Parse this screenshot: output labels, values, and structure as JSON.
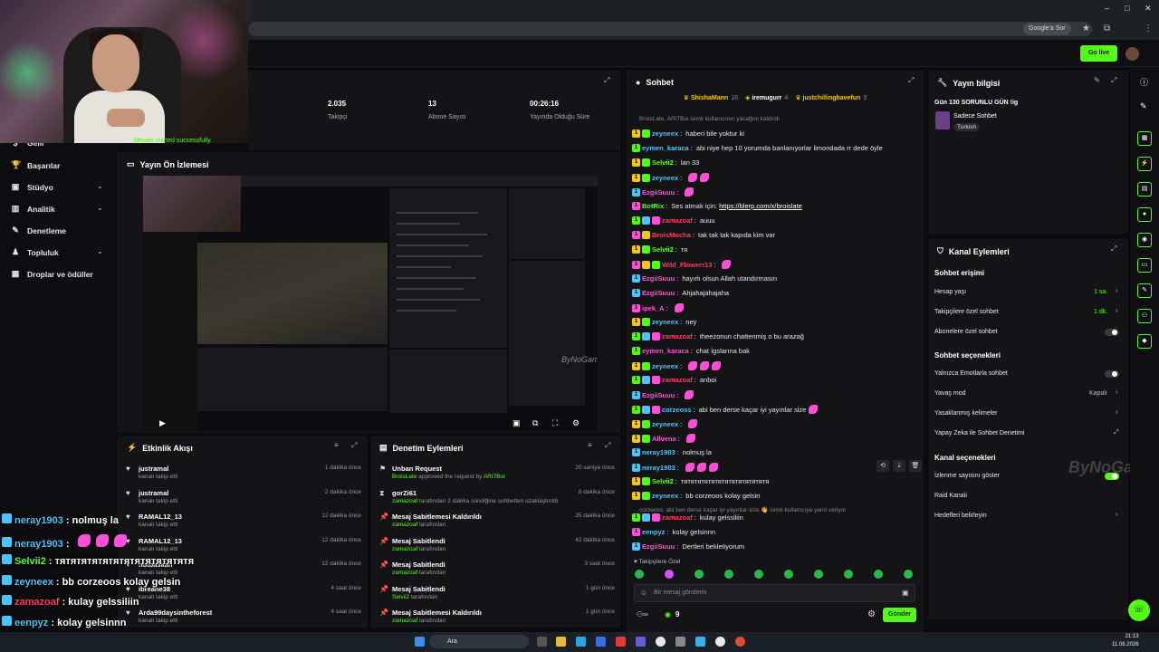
{
  "browser": {
    "google_ask": "Google'a Sor"
  },
  "app": {
    "go_live": "Go live"
  },
  "stream_note": "Stream started successfully.",
  "nav": {
    "items": [
      {
        "label": "Gelir",
        "icon": "dollar-icon"
      },
      {
        "label": "Başarılar",
        "icon": "trophy-icon"
      },
      {
        "label": "Stüdyo",
        "icon": "studio-icon",
        "chevron": true
      },
      {
        "label": "Analitik",
        "icon": "analytics-icon",
        "chevron": true
      },
      {
        "label": "Denetleme",
        "icon": "moderation-icon"
      },
      {
        "label": "Topluluk",
        "icon": "community-icon",
        "chevron": true
      },
      {
        "label": "Droplar ve ödüller",
        "icon": "drops-icon"
      }
    ]
  },
  "stats": [
    {
      "value": "2.035",
      "label": "Takipçi"
    },
    {
      "value": "13",
      "label": "Abone Sayısı"
    },
    {
      "value": "00:26:16",
      "label": "Yayında Olduğu Süre"
    }
  ],
  "preview": {
    "title": "Yayın Ön İzlemesi",
    "watermark": "ByNoGame"
  },
  "activity": {
    "title": "Etkinlik Akışı",
    "items": [
      {
        "user": "justramal",
        "sub": "kanalı takip etti",
        "time": "1 dakika önce"
      },
      {
        "user": "justramal",
        "sub": "kanalı takip etti",
        "time": "2 dakika önce"
      },
      {
        "user": "RAMAL12_13",
        "sub": "kanalı takip etti",
        "time": "12 dakika önce"
      },
      {
        "user": "RAMAL12_13",
        "sub": "kanalı takip etti",
        "time": "12 dakika önce"
      },
      {
        "user": "notbaskan",
        "sub": "kanalı takip etti",
        "time": "12 dakika önce"
      },
      {
        "user": "ibreane38",
        "sub": "kanalı takip etti",
        "time": "4 saat önce"
      },
      {
        "user": "Arda99daysintheforest",
        "sub": "kanalı takip etti",
        "time": "4 saat önce"
      }
    ]
  },
  "moderation": {
    "title": "Denetim Eylemleri",
    "items": [
      {
        "title": "Unban Request",
        "sub_user": "BroisLate",
        "sub_text": " approved the request by ",
        "sub_user2": "ARI7Boi",
        "time": "20 saniye önce"
      },
      {
        "title": "gorZi61",
        "sub_user": "zamazoaf",
        "sub_text": " tarafından 2 dakika süreliğine sohbetten uzaklaştırıldı",
        "sub_user2": "",
        "time": "6 dakika önce"
      },
      {
        "title": "Mesaj Sabitlemesi Kaldırıldı",
        "sub_user": "zamazoaf",
        "sub_text": " tarafından",
        "sub_user2": "",
        "time": "25 dakika önce"
      },
      {
        "title": "Mesaj Sabitlendi",
        "sub_user": "zamazoaf",
        "sub_text": " tarafından",
        "sub_user2": "",
        "time": "42 dakika önce"
      },
      {
        "title": "Mesaj Sabitlendi",
        "sub_user": "zamazoaf",
        "sub_text": " tarafından",
        "sub_user2": "",
        "time": "3 saat önce"
      },
      {
        "title": "Mesaj Sabitlendi",
        "sub_user": "Selvii2",
        "sub_text": " tarafından",
        "sub_user2": "",
        "time": "1 gün önce"
      },
      {
        "title": "Mesaj Sabitlemesi Kaldırıldı",
        "sub_user": "zamazoaf",
        "sub_text": " tarafından",
        "sub_user2": "",
        "time": "1 gün önce"
      }
    ]
  },
  "chat": {
    "title": "Sohbet",
    "top_gifters": [
      {
        "name": "ShishaMann",
        "count": "16"
      },
      {
        "name": "iremugurr",
        "count": "4"
      },
      {
        "name": "justchillinghavefun",
        "count": "3"
      }
    ],
    "system_top": "BroisLate, ARI7Boi isimli kullanıcının yasağını kaldırdı",
    "messages": [
      {
        "user": "zeyneex",
        "color": "#4fc3f7",
        "text": "haberi bile yoktur ki",
        "emotes": 0
      },
      {
        "user": "eymen_karaca",
        "color": "#4fc3f7",
        "text": "abi niye hep 10 yorumda banlanıyorlar limondada rr dede öyle",
        "emotes": 0
      },
      {
        "user": "Selvii2",
        "color": "#53fc18",
        "text": "lan 33",
        "emotes": 0
      },
      {
        "user": "zeyneex",
        "color": "#4fc3f7",
        "text": "",
        "emotes": 2
      },
      {
        "user": "EzgiiSuuu",
        "color": "#ff4fd8",
        "text": "",
        "emotes": 1
      },
      {
        "user": "BotRix",
        "color": "#53fc18",
        "text": "Ses atmak için: ",
        "link": "https://blerp.com/x/broislate",
        "emotes": 0
      },
      {
        "user": "zamazoaf",
        "color": "#ff3b5c",
        "text": "auuu",
        "emotes": 0
      },
      {
        "user": "BroisMocha",
        "color": "#ff3b5c",
        "text": "tak tak tak kapıda kim var",
        "emotes": 0
      },
      {
        "user": "Selvii2",
        "color": "#53fc18",
        "text": "тя",
        "emotes": 0
      },
      {
        "user": "Wild_Flowerr13",
        "color": "#ff3b5c",
        "text": "",
        "emotes": 1
      },
      {
        "user": "EzgiiSuuu",
        "color": "#ff4fd8",
        "text": "hayırlı olsun Allah utandırmasın",
        "emotes": 0
      },
      {
        "user": "EzgiiSuuu",
        "color": "#ff4fd8",
        "text": "Ahjahajahajaha",
        "emotes": 0
      },
      {
        "user": "ipek_A",
        "color": "#ff4fd8",
        "text": "",
        "emotes": 1
      },
      {
        "user": "zeyneex",
        "color": "#4fc3f7",
        "text": "ney",
        "emotes": 0
      },
      {
        "user": "zamazoaf",
        "color": "#ff3b5c",
        "text": "theezonun chattenmiş o bu arazağ",
        "emotes": 0
      },
      {
        "user": "eymen_karaca",
        "color": "#ff4fd8",
        "text": "chat İgslarına bak",
        "emotes": 0
      },
      {
        "user": "zeyneex",
        "color": "#4fc3f7",
        "text": "",
        "emotes": 3
      },
      {
        "user": "zamazoaf",
        "color": "#ff3b5c",
        "text": "anboi",
        "emotes": 0
      },
      {
        "user": "EzgiiSuuu",
        "color": "#ff4fd8",
        "text": "",
        "emotes": 1
      },
      {
        "user": "corzeoss",
        "color": "#4fc3f7",
        "text": "abi ben derse kaçar iyi yayınlar size",
        "emotes": 1
      },
      {
        "user": "zeyneex",
        "color": "#4fc3f7",
        "text": "",
        "emotes": 1
      },
      {
        "user": "Allvena",
        "color": "#ff4fd8",
        "text": "",
        "emotes": 1
      },
      {
        "user": "neray1903",
        "color": "#4fc3f7",
        "text": "nolmuş la",
        "emotes": 0
      },
      {
        "user": "neray1903",
        "color": "#4fc3f7",
        "text": "",
        "emotes": 3
      },
      {
        "user": "Selvii2",
        "color": "#53fc18",
        "text": "тятятятятятятятятятятятятя",
        "emotes": 0
      },
      {
        "user": "zeyneex",
        "color": "#4fc3f7",
        "text": "bb corzeoos kolay gelsin",
        "emotes": 0
      }
    ],
    "reply_note": "corzeoss: abi ben derse kaçar iyi yayınlar size 👋 isimli kullanıcıya yanıt veriyor",
    "messages_bottom": [
      {
        "user": "zamazoaf",
        "color": "#ff3b5c",
        "text": "kulay gelssiliin"
      },
      {
        "user": "eenpyz",
        "color": "#4fc3f7",
        "text": "kolay gelsinnn"
      },
      {
        "user": "EzgiiSuuu",
        "color": "#ff4fd8",
        "text": "Dertleri bekletiyorum"
      }
    ],
    "followers_only": "Takipçilere Özel",
    "input_placeholder": "Bir mesaj gönderin",
    "kick_count": "9",
    "send": "Gönder"
  },
  "stream_info": {
    "title": "Yayın bilgisi",
    "stream_title": "Gün 130 SORUNLU GÜN !ig",
    "category": "Sadece Sohbet",
    "tag": "Turkish"
  },
  "channel_actions": {
    "title": "Kanal Eylemleri",
    "chat_access": "Sohbet erişimi",
    "account_age": {
      "label": "Hesap yaşı",
      "value": "1 sa."
    },
    "followers_chat": {
      "label": "Takipçilere özel sohbet",
      "value": "1 dk."
    },
    "subs_chat": {
      "label": "Abonelere özel sohbet"
    },
    "chat_options": "Sohbet seçenekleri",
    "emote_only": {
      "label": "Yalnızca Emotlarla sohbet"
    },
    "slow_mode": {
      "label": "Yavaş mod",
      "value": "Kapalı"
    },
    "banned_words": {
      "label": "Yasaklanmış kelimeler"
    },
    "ai_moderation": {
      "label": "Yapay Zeka ile Sohbet Denetimi"
    },
    "channel_options": "Kanal seçenekleri",
    "view_count": {
      "label": "İzlenme sayısını göster"
    },
    "raid": {
      "label": "Raid Kanalı"
    },
    "goals": {
      "label": "Hedefleri belirleyin"
    },
    "watermark": "ByNoGame"
  },
  "overlay_chat": [
    {
      "user": "neray1903",
      "text": " : nolmuş la"
    },
    {
      "user": "neray1903",
      "text": " : "
    },
    {
      "user": "Selvii2",
      "text": " : тятятятятятятятятятятятятя"
    },
    {
      "user": "zeyneex",
      "text": " : bb corzeoos kolay gelsin"
    },
    {
      "user": "zamazoaf",
      "text": " : kulay gelssiliin"
    },
    {
      "user": "eenpyz",
      "text": " : kolay gelsinnn"
    },
    {
      "user": "EzgiiSuuu",
      "text": " : Dertleri bekletiyorum"
    }
  ],
  "taskbar": {
    "search": "Ara",
    "time": "21:13",
    "date": "11.08.2026"
  }
}
